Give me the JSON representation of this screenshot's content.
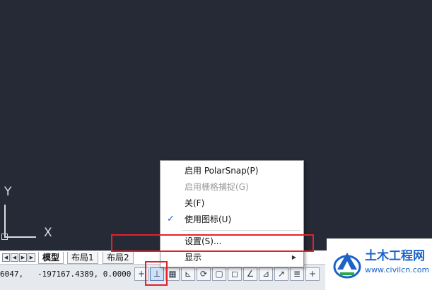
{
  "canvas": {
    "background": "#262a36",
    "ucs": {
      "y_label": "Y",
      "x_label": "X"
    }
  },
  "layout_tabs": {
    "nav_buttons": [
      "first",
      "previous",
      "next",
      "last"
    ],
    "tabs": [
      {
        "label": "模型",
        "active": true
      },
      {
        "label": "布局1",
        "active": false
      },
      {
        "label": "布局2",
        "active": false
      }
    ]
  },
  "status_bar": {
    "coordinates": "6047,   -197167.4389, 0.0000",
    "buttons": [
      {
        "name": "infer-constraints-button",
        "icon": "+",
        "active": false
      },
      {
        "name": "snap-mode-button",
        "icon": "⊥",
        "active": true
      },
      {
        "name": "grid-display-button",
        "icon": "▦",
        "active": false
      },
      {
        "name": "ortho-mode-button",
        "icon": "⊾",
        "active": false
      },
      {
        "name": "polar-tracking-button",
        "icon": "⟳",
        "active": false
      },
      {
        "name": "object-snap-button",
        "icon": "▢",
        "active": false
      },
      {
        "name": "3d-object-snap-button",
        "icon": "◻",
        "active": false
      },
      {
        "name": "object-snap-tracking-button",
        "icon": "∠",
        "active": false
      },
      {
        "name": "dynamic-ucs-button",
        "icon": "⊿",
        "active": false
      },
      {
        "name": "dynamic-input-button",
        "icon": "↗",
        "active": false
      },
      {
        "name": "lineweight-button",
        "icon": "≣",
        "active": false
      },
      {
        "name": "quick-properties-button",
        "icon": "+",
        "active": false
      }
    ]
  },
  "context_menu": {
    "items": [
      {
        "label": "启用 PolarSnap(P)",
        "disabled": false,
        "checked": false,
        "submenu": false
      },
      {
        "label": "启用栅格捕捉(G)",
        "disabled": true,
        "checked": false,
        "submenu": false
      },
      {
        "label": "关(F)",
        "disabled": false,
        "checked": false,
        "submenu": false
      },
      {
        "label": "使用图标(U)",
        "disabled": false,
        "checked": true,
        "submenu": false
      },
      {
        "label": "设置(S)...",
        "disabled": false,
        "checked": false,
        "submenu": false
      },
      {
        "label": "显示",
        "disabled": false,
        "checked": false,
        "submenu": true
      }
    ]
  },
  "annotation_color": "#e4212b",
  "watermark": {
    "name": "土木工程网",
    "url": "www.civilcn.com",
    "color": "#1b63c7"
  }
}
